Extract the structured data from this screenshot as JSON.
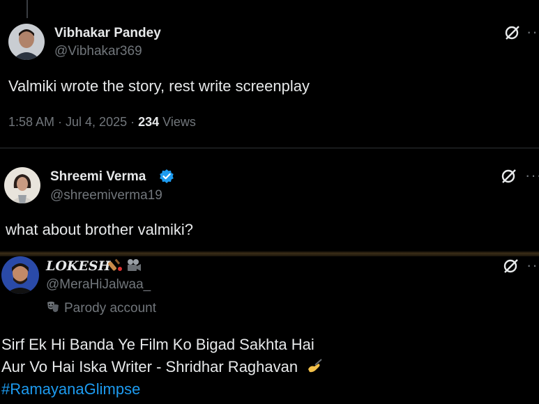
{
  "post1": {
    "name": "Vibhakar Pandey",
    "handle": "@Vibhakar369",
    "text": "Valmiki wrote the story, rest write screenplay",
    "time": "1:58 AM · Jul 4, 2025 · ",
    "views_count": "234",
    "views_label": " Views",
    "more": "···"
  },
  "post2": {
    "name": "Shreemi Verma",
    "handle": "@shreemiverma19",
    "text": "what about brother valmiki?",
    "more": "···"
  },
  "post3": {
    "name": "LOKESH",
    "handle": "@MeraHiJalwaa_",
    "parody_label": "Parody account",
    "line1": "Sirf Ek Hi Banda Ye Film Ko Bigad Sakhta Hai",
    "line2": "Aur Vo Hai Iska Writer - Shridhar Raghavan",
    "hashtag": "#RamayanaGlimpse",
    "more": "···"
  },
  "colors": {
    "accent": "#1d9bf0",
    "muted": "#71767b",
    "text": "#e7e9ea",
    "bg": "#000000"
  }
}
